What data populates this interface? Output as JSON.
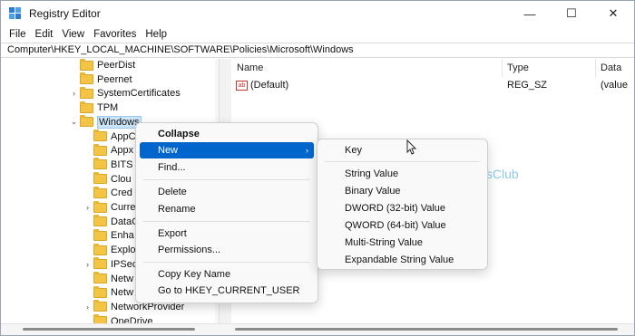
{
  "window": {
    "title": "Registry Editor",
    "minimize": "—",
    "maximize": "☐",
    "close": "✕"
  },
  "menu": [
    "File",
    "Edit",
    "View",
    "Favorites",
    "Help"
  ],
  "address": "Computer\\HKEY_LOCAL_MACHINE\\SOFTWARE\\Policies\\Microsoft\\Windows",
  "tree": [
    {
      "label": "PeerDist",
      "chev": "",
      "level": 0
    },
    {
      "label": "Peernet",
      "chev": "",
      "level": 0
    },
    {
      "label": "SystemCertificates",
      "chev": "›",
      "level": 0
    },
    {
      "label": "TPM",
      "chev": "",
      "level": 0
    },
    {
      "label": "Windows",
      "chev": "⌄",
      "level": 0,
      "selected": true
    },
    {
      "label": "AppC",
      "chev": "",
      "level": 1
    },
    {
      "label": "Appx",
      "chev": "",
      "level": 1
    },
    {
      "label": "BITS",
      "chev": "",
      "level": 1
    },
    {
      "label": "Clou",
      "chev": "",
      "level": 1
    },
    {
      "label": "Cred",
      "chev": "",
      "level": 1
    },
    {
      "label": "Curre",
      "chev": "›",
      "level": 1
    },
    {
      "label": "DataC",
      "chev": "",
      "level": 1
    },
    {
      "label": "Enha",
      "chev": "",
      "level": 1
    },
    {
      "label": "Explo",
      "chev": "",
      "level": 1
    },
    {
      "label": "IPSec",
      "chev": "›",
      "level": 1
    },
    {
      "label": "Netw",
      "chev": "",
      "level": 1
    },
    {
      "label": "Netw",
      "chev": "",
      "level": 1
    },
    {
      "label": "NetworkProvider",
      "chev": "›",
      "level": 1
    },
    {
      "label": "OneDrive",
      "chev": "",
      "level": 1
    }
  ],
  "columns": {
    "name": "Name",
    "type": "Type",
    "data": "Data"
  },
  "values": [
    {
      "icon": "ab",
      "name": "(Default)",
      "type": "REG_SZ",
      "data": "(value n"
    }
  ],
  "context_menu": {
    "items": [
      {
        "label": "Collapse",
        "bold": true
      },
      {
        "label": "New",
        "highlighted": true,
        "submenu_arrow": "›"
      },
      {
        "label": "Find..."
      },
      {
        "label": "Delete"
      },
      {
        "label": "Rename"
      },
      {
        "label": "Export"
      },
      {
        "label": "Permissions..."
      },
      {
        "label": "Copy Key Name"
      },
      {
        "label": "Go to HKEY_CURRENT_USER"
      }
    ]
  },
  "submenu": {
    "items": [
      "Key",
      "String Value",
      "Binary Value",
      "DWORD (32-bit) Value",
      "QWORD (64-bit) Value",
      "Multi-String Value",
      "Expandable String Value"
    ]
  },
  "watermark": "TheWindowsClub",
  "colors": {
    "highlight": "#0066cc",
    "selection": "#cce4f7",
    "folder": "#f4c544"
  }
}
